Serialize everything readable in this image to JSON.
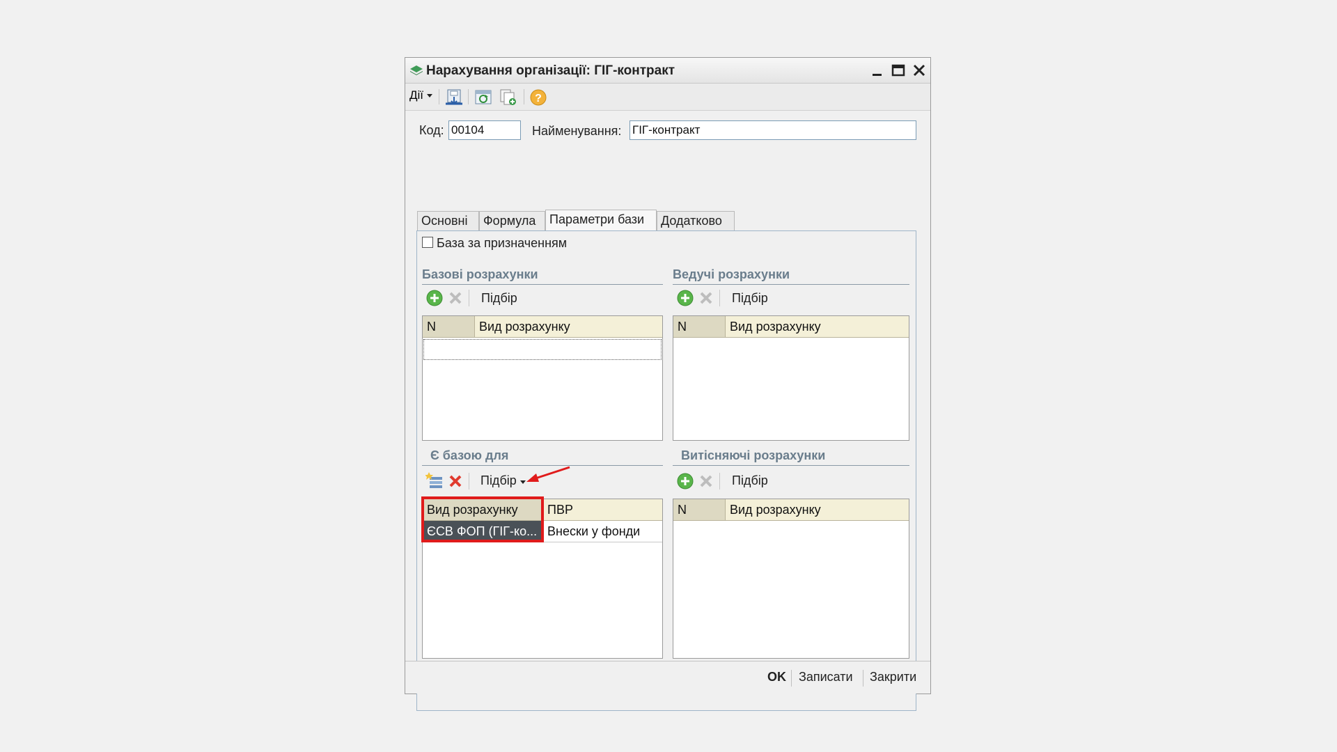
{
  "window": {
    "title": "Нарахування організації: ГІГ-контракт"
  },
  "toolbar": {
    "actions_label": "Дії"
  },
  "form": {
    "code_label": "Код:",
    "code_value": "00104",
    "name_label": "Найменування:",
    "name_value": "ГІГ-контракт"
  },
  "tabs": [
    {
      "label": "Основні"
    },
    {
      "label": "Формула"
    },
    {
      "label": "Параметри бази"
    },
    {
      "label": "Додатково"
    }
  ],
  "base_by_purpose": {
    "label": "База за призначенням",
    "checked": false
  },
  "base_calcs": {
    "title": "Базові розрахунки",
    "select_label": "Підбір",
    "col_n": "N",
    "col_kind": "Вид розрахунку"
  },
  "leading_calcs": {
    "title": "Ведучі розрахунки",
    "select_label": "Підбір",
    "col_n": "N",
    "col_kind": "Вид розрахунку"
  },
  "is_base_for": {
    "title": "Є базою для",
    "select_label": "Підбір",
    "col_kind": "Вид розрахунку",
    "col_pvr": "ПВР",
    "rows": [
      {
        "kind": "ЄСВ ФОП (ГІГ-ко...",
        "pvr": "Внески у фонди"
      }
    ]
  },
  "displacing_calcs": {
    "title": "Витісняючі розрахунки",
    "select_label": "Підбір",
    "col_n": "N",
    "col_kind": "Вид розрахунку"
  },
  "footer": {
    "ok": "OK",
    "save": "Записати",
    "close": "Закрити"
  },
  "colors": {
    "highlight": "#e01b1b",
    "selected_row": "#4a5157",
    "header_bg": "#f4f0d8"
  }
}
